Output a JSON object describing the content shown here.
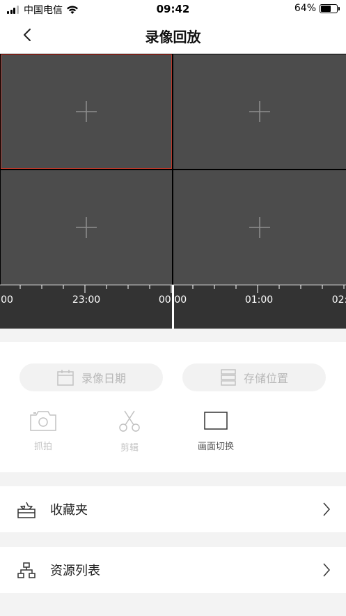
{
  "status_bar": {
    "carrier": "中国电信",
    "time": "09:42",
    "battery_text": "64%",
    "battery_level": 0.64
  },
  "nav": {
    "title": "录像回放",
    "back_icon": "chevron-left-icon"
  },
  "video_grid": {
    "cells": [
      {
        "icon": "plus-icon",
        "selected": true
      },
      {
        "icon": "plus-icon",
        "selected": false
      },
      {
        "icon": "plus-icon",
        "selected": false
      },
      {
        "icon": "plus-icon",
        "selected": false
      }
    ],
    "selected_color": "#c0392b"
  },
  "timeline": {
    "labels": [
      "00",
      "23:00",
      "00:00",
      "01:00",
      "02:"
    ]
  },
  "controls": {
    "date_button": {
      "label": "录像日期",
      "icon": "calendar-icon"
    },
    "storage_button": {
      "label": "存储位置",
      "icon": "storage-icon"
    },
    "tools": [
      {
        "label": "抓拍",
        "icon": "camera-icon"
      },
      {
        "label": "剪辑",
        "icon": "scissors-icon"
      },
      {
        "label": "画面切换",
        "icon": "screen-switch-icon"
      }
    ]
  },
  "list": [
    {
      "label": "收藏夹",
      "icon": "favorites-icon"
    },
    {
      "label": "资源列表",
      "icon": "resource-tree-icon"
    }
  ]
}
